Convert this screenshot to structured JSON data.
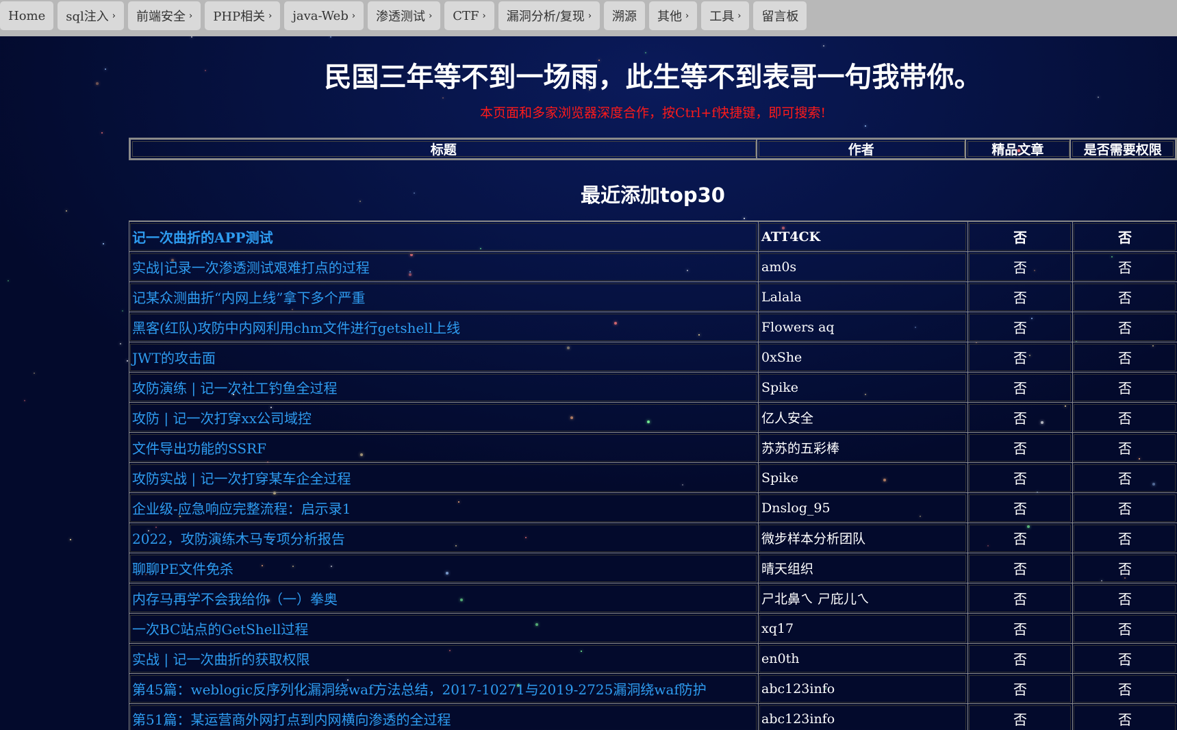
{
  "nav": {
    "items": [
      {
        "label": "Home",
        "has_menu": false
      },
      {
        "label": "sql注入",
        "has_menu": true
      },
      {
        "label": "前端安全",
        "has_menu": true
      },
      {
        "label": "PHP相关",
        "has_menu": true
      },
      {
        "label": "java-Web",
        "has_menu": true
      },
      {
        "label": "渗透测试",
        "has_menu": true
      },
      {
        "label": "CTF",
        "has_menu": true
      },
      {
        "label": "漏洞分析/复现",
        "has_menu": true
      },
      {
        "label": "溯源",
        "has_menu": false
      },
      {
        "label": "其他",
        "has_menu": true
      },
      {
        "label": "工具",
        "has_menu": true
      },
      {
        "label": "留言板",
        "has_menu": false
      }
    ]
  },
  "header": {
    "title": "民国三年等不到一场雨，此生等不到表哥一句我带你。",
    "search_hint": "本页面和多家浏览器深度合作，按Ctrl+f快捷键，即可搜索!"
  },
  "table_header": {
    "title": "标题",
    "author": "作者",
    "premium": "精品文章",
    "permission": "是否需要权限"
  },
  "section": {
    "title": "最近添加top30"
  },
  "articles": [
    {
      "title": "记一次曲折的APP测试",
      "author": "ATT4CK",
      "premium": "否",
      "permission": "否",
      "featured": true
    },
    {
      "title": "实战|记录一次渗透测试艰难打点的过程",
      "author": "am0s",
      "premium": "否",
      "permission": "否"
    },
    {
      "title": "记某众测曲折“内网上线”拿下多个严重",
      "author": "Lalala",
      "premium": "否",
      "permission": "否"
    },
    {
      "title": "黑客(红队)攻防中内网利用chm文件进行getshell上线",
      "author": "Flowers aq",
      "premium": "否",
      "permission": "否"
    },
    {
      "title": "JWT的攻击面",
      "author": "0xShe",
      "premium": "否",
      "permission": "否"
    },
    {
      "title": "攻防演练 | 记一次社工钓鱼全过程",
      "author": "Spike",
      "premium": "否",
      "permission": "否"
    },
    {
      "title": "攻防 | 记一次打穿xx公司域控",
      "author": "亿人安全",
      "premium": "否",
      "permission": "否"
    },
    {
      "title": "文件导出功能的SSRF",
      "author": "苏苏的五彩棒",
      "premium": "否",
      "permission": "否"
    },
    {
      "title": "攻防实战 | 记一次打穿某车企全过程",
      "author": "Spike",
      "premium": "否",
      "permission": "否"
    },
    {
      "title": "企业级-应急响应完整流程：启示录1",
      "author": "Dnslog_95",
      "premium": "否",
      "permission": "否"
    },
    {
      "title": "2022，攻防演练木马专项分析报告",
      "author": "微步样本分析团队",
      "premium": "否",
      "permission": "否"
    },
    {
      "title": "聊聊PE文件免杀",
      "author": "晴天组织",
      "premium": "否",
      "permission": "否"
    },
    {
      "title": "内存马再学不会我给你（一）拳奥",
      "author": "ㄕ北鼻ㄟ ㄕ庇儿ㄟ",
      "premium": "否",
      "permission": "否"
    },
    {
      "title": "一次BC站点的GetShell过程",
      "author": "xq17",
      "premium": "否",
      "permission": "否"
    },
    {
      "title": "实战 | 记一次曲折的获取权限",
      "author": "en0th",
      "premium": "否",
      "permission": "否"
    },
    {
      "title": "第45篇：weblogic反序列化漏洞绕waf方法总结，2017-10271与2019-2725漏洞绕waf防护",
      "author": "abc123info",
      "premium": "否",
      "permission": "否"
    },
    {
      "title": "第51篇：某运营商外网打点到内网横向渗透的全过程",
      "author": "abc123info",
      "premium": "否",
      "permission": "否"
    }
  ],
  "colors": {
    "background": "#030a2c",
    "link": "#2e9cf0",
    "hint": "#ff1a1a",
    "navbar": "#b8b8b8",
    "nav_item": "#d9d9d9"
  }
}
